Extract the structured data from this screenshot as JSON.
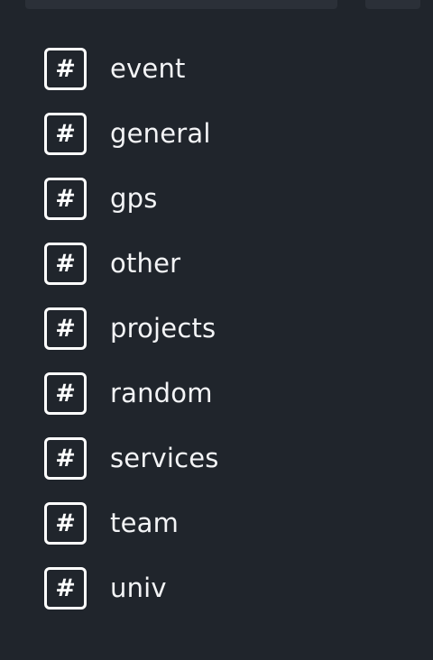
{
  "channels": [
    {
      "label": "event",
      "icon": "hash-icon",
      "glyph": "#"
    },
    {
      "label": "general",
      "icon": "hash-icon",
      "glyph": "#"
    },
    {
      "label": "gps",
      "icon": "hash-icon",
      "glyph": "#"
    },
    {
      "label": "other",
      "icon": "hash-icon",
      "glyph": "#"
    },
    {
      "label": "projects",
      "icon": "hash-icon",
      "glyph": "#"
    },
    {
      "label": "random",
      "icon": "hash-icon",
      "glyph": "#"
    },
    {
      "label": "services",
      "icon": "hash-icon",
      "glyph": "#"
    },
    {
      "label": "team",
      "icon": "hash-icon",
      "glyph": "#"
    },
    {
      "label": "univ",
      "icon": "hash-icon",
      "glyph": "#"
    }
  ],
  "colors": {
    "background": "#20252c",
    "top_bar": "#2b3038",
    "text": "#f3f4f6",
    "icon_border": "#ffffff"
  }
}
